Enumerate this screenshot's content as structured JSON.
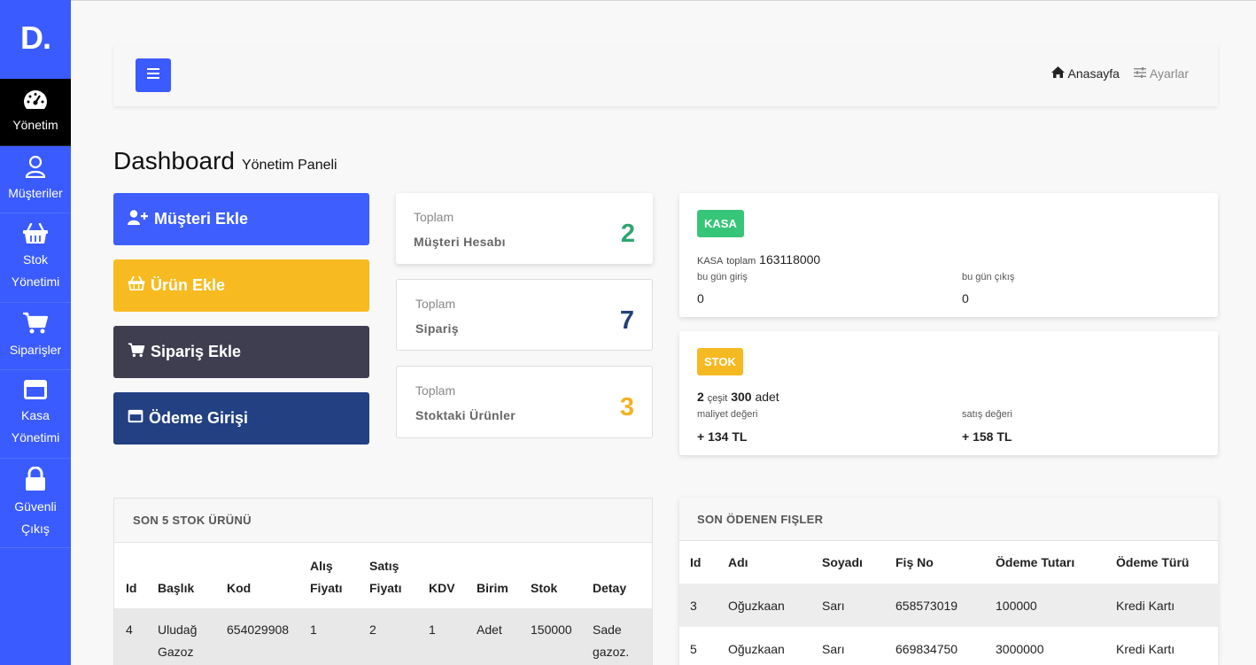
{
  "logo": "D.",
  "sidebar": {
    "items": [
      {
        "label": [
          "Yönetim"
        ],
        "icon": "dashboard-gauge-icon",
        "active": true
      },
      {
        "label": [
          "Müşteriler"
        ],
        "icon": "user-icon"
      },
      {
        "label": [
          "Stok",
          "Yönetimi"
        ],
        "icon": "basket-icon"
      },
      {
        "label": [
          "Siparişler"
        ],
        "icon": "cart-icon"
      },
      {
        "label": [
          "Kasa",
          "Yönetimi"
        ],
        "icon": "credit-card-icon"
      },
      {
        "label": [
          "Güvenli",
          "Çıkış"
        ],
        "icon": "lock-icon"
      }
    ]
  },
  "header": {
    "menu_icon": "hamburger-icon",
    "home_label": "Anasayfa",
    "settings_label": "Ayarlar"
  },
  "page": {
    "title": "Dashboard",
    "subtitle": "Yönetim Paneli"
  },
  "actions": {
    "add_customer": "Müşteri Ekle",
    "add_product": "Ürün Ekle",
    "add_order": "Sipariş Ekle",
    "payment_entry": "Ödeme Girişi"
  },
  "stats": [
    {
      "top_label": "Toplam",
      "label": "Müşteri Hesabı",
      "value": "2",
      "color": "#2fa46e"
    },
    {
      "top_label": "Toplam",
      "label": "Sipariş",
      "value": "7",
      "color": "#243f7a"
    },
    {
      "top_label": "Toplam",
      "label": "Stoktaki Ürünler",
      "value": "3",
      "color": "#f3b21f"
    }
  ],
  "kasa": {
    "badge": "KASA",
    "prefix": "KASA",
    "total_label": "toplam",
    "total_value": "163118000",
    "in_label": "bu gün giriş",
    "in_value": "0",
    "out_label": "bu gün çıkış",
    "out_value": "0"
  },
  "stok": {
    "badge": "STOK",
    "variety_count": "2",
    "variety_label": "çeşit",
    "unit_count": "300",
    "unit_label": "adet",
    "cost_label": "maliyet değeri",
    "cost_value": "+ 134 TL",
    "sale_label": "satış değeri",
    "sale_value": "+ 158 TL"
  },
  "stock_table": {
    "title": "SON 5 STOK ÜRÜNÜ",
    "columns": [
      "Id",
      "Başlık",
      "Kod",
      "Alış Fiyatı",
      "Satış Fiyatı",
      "KDV",
      "Birim",
      "Stok",
      "Detay"
    ],
    "rows": [
      [
        "4",
        "Uludağ Gazoz",
        "654029908",
        "1",
        "2",
        "1",
        "Adet",
        "150000",
        "Sade gazoz."
      ]
    ]
  },
  "receipt_table": {
    "title": "SON ÖDENEN FIŞLER",
    "columns": [
      "Id",
      "Adı",
      "Soyadı",
      "Fiş No",
      "Ödeme Tutarı",
      "Ödeme Türü"
    ],
    "rows": [
      [
        "3",
        "Oğuzkaan",
        "Sarı",
        "658573019",
        "100000",
        "Kredi Kartı"
      ],
      [
        "5",
        "Oğuzkaan",
        "Sarı",
        "669834750",
        "3000000",
        "Kredi Kartı"
      ]
    ]
  }
}
